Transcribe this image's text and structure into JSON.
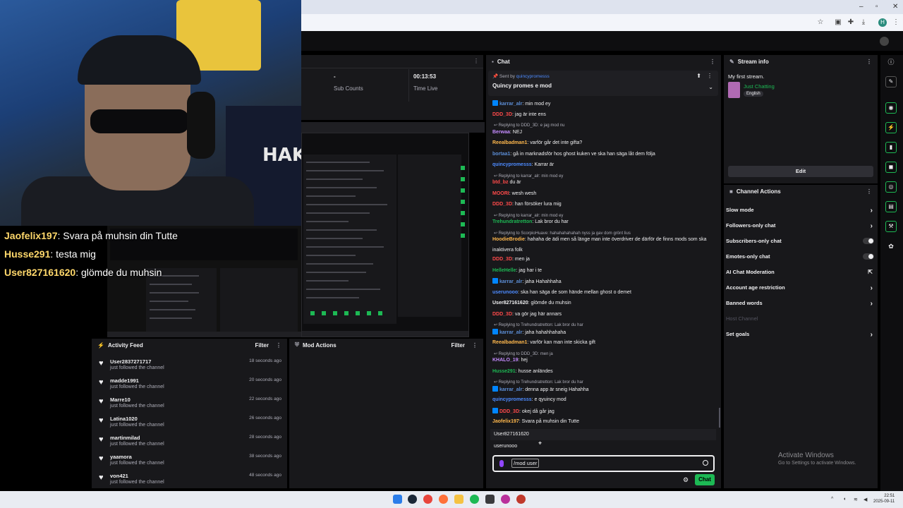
{
  "browser": {
    "profile_letter": "H"
  },
  "overlay_chat": [
    {
      "user": "Jaofelix197",
      "text": ": Svara på muhsin din Tutte"
    },
    {
      "user": "Husse291",
      "text": ": testa mig"
    },
    {
      "user": "User827161620",
      "text": ": glömde du muhsin"
    }
  ],
  "stats": {
    "dash": "-",
    "sub_counts_label": "Sub Counts",
    "time_live_value": "00:13:53",
    "time_live_label": "Time Live"
  },
  "activity_feed": {
    "title": "Activity Feed",
    "filter": "Filter",
    "items": [
      {
        "user": "User2837271717",
        "desc": "just followed the channel",
        "time": "18 seconds ago"
      },
      {
        "user": "madde1991",
        "desc": "just followed the channel",
        "time": "20 seconds ago"
      },
      {
        "user": "Marre10",
        "desc": "just followed the channel",
        "time": "22 seconds ago"
      },
      {
        "user": "Latina1020",
        "desc": "just followed the channel",
        "time": "26 seconds ago"
      },
      {
        "user": "martinmilad",
        "desc": "just followed the channel",
        "time": "28 seconds ago"
      },
      {
        "user": "yaamora",
        "desc": "just followed the channel",
        "time": "38 seconds ago"
      },
      {
        "user": "von421",
        "desc": "just followed the channel",
        "time": "48 seconds ago"
      }
    ]
  },
  "mod_actions": {
    "title": "Mod Actions",
    "filter": "Filter"
  },
  "chat": {
    "title": "Chat",
    "pinned_sent_by_prefix": "Sent by ",
    "pinned_sent_by_user": "quincypromesss",
    "pinned_text": "Quincy promes e mod",
    "messages": [
      {
        "user": "karrar_alr",
        "text": ": min mod ey",
        "color": "#5c8ed6",
        "mod": true
      },
      {
        "user": "DDD_3D",
        "text": ": jag är inte ens",
        "color": "#ff4a4a"
      },
      {
        "reply": "Replying to DDD_3D: e jag mod nu"
      },
      {
        "user": "Berwaa",
        "text": ": NEJ",
        "color": "#c58cff"
      },
      {
        "user": "Reealbadman1",
        "text": ": varför går det inte gifta?",
        "color": "#ffb84d"
      },
      {
        "user": "bortaa1",
        "text": ": gå in marknadsför hos ghost kuken ve ska han säga låt dem följa",
        "color": "#5c8ed6"
      },
      {
        "user": "quincypromesss",
        "text": ": Karrar är",
        "color": "#4d8bff"
      },
      {
        "reply": "Replying to karrar_alr: min mod ey"
      },
      {
        "user": "btd_bz",
        "text": " du är",
        "color": "#ff4a4a"
      },
      {
        "user": "MOORI",
        "text": ": wesh wesh",
        "color": "#ff4a4a"
      },
      {
        "user": "DDD_3D",
        "text": ": han försöker lura mig",
        "color": "#ff4a4a"
      },
      {
        "reply": "Replying to karrar_alr: min mod ey"
      },
      {
        "user": "Trehundratretton",
        "text": ": Lak bror du har",
        "color": "#1db954"
      },
      {
        "reply": "Replying to ScorpioHuave: hahahahahahah nyss ja gav dom grönt lius"
      },
      {
        "user": "HoodieBrodie",
        "text": ": hahaha de ädi men så länge man inte överdriver de därför de finns mods som ska",
        "color": "#ffb84d"
      },
      {
        "cont": "inaktivera folk"
      },
      {
        "user": "DDD_3D",
        "text": ": men ja",
        "color": "#ff4a4a"
      },
      {
        "user": "HelleHelle",
        "text": ": jag har i te",
        "color": "#1db954"
      },
      {
        "user": "karrar_alr",
        "text": ": jaha Hahahhaha",
        "color": "#5c8ed6",
        "mod": true
      },
      {
        "user": "userunooo",
        "text": ": ska han säga de som hände mellan ghost o demet",
        "color": "#4d8bff"
      },
      {
        "user": "User827161620",
        "text": ": glömde du muhsin",
        "color": "#efeff1"
      },
      {
        "user": "DDD_3D",
        "text": ": va gör jag här annars",
        "color": "#ff4a4a"
      },
      {
        "reply": "Replying to Trehundratretton: Lak bror du har"
      },
      {
        "user": "karrar_alr",
        "text": ": jaha hahahhahaha",
        "color": "#5c8ed6",
        "mod": true
      },
      {
        "user": "Reealbadman1",
        "text": ": varför kan man inte skicka gift",
        "color": "#ffb84d"
      },
      {
        "reply": "Replying to DDD_3D: men ja"
      },
      {
        "user": "KHALO_19",
        "text": ": hej",
        "color": "#c58cff"
      },
      {
        "user": "Husse291",
        "text": ": husse anländes",
        "color": "#1db954"
      },
      {
        "reply": "Replying to Trehundratretton: Lak bror du har"
      },
      {
        "user": "karrar_alr",
        "text": ": denna app är sneig Hahahha",
        "color": "#5c8ed6",
        "mod": true
      },
      {
        "user": "quincypromesss",
        "text": ": e qyuincy mod",
        "color": "#4d8bff"
      },
      {
        "user": "DDD_3D",
        "text": ": okej då går jag",
        "color": "#ff4a4a",
        "mod": true
      },
      {
        "user": "Jaofelix197",
        "text": ": Svara på muhsin din Tutte",
        "color": "#ffb84d"
      },
      {
        "user": "Husse291",
        "text": ": testa mig",
        "color": "#1db954"
      }
    ],
    "suggestions": [
      "User827161620",
      "userunooo"
    ],
    "input_value": "/mod user",
    "send_label": "Chat"
  },
  "stream_info": {
    "title": "Stream info",
    "stream_title": "My first stream.",
    "category": "Just Chatting",
    "tag": "English",
    "edit_label": "Edit"
  },
  "channel_actions": {
    "title": "Channel Actions",
    "items": [
      {
        "label": "Slow mode",
        "kind": "arrow"
      },
      {
        "label": "Followers-only chat",
        "kind": "arrow"
      },
      {
        "label": "Subscribers-only chat",
        "kind": "toggle"
      },
      {
        "label": "Emotes-only chat",
        "kind": "toggle"
      },
      {
        "label": "AI Chat Moderation",
        "kind": "external"
      },
      {
        "label": "Account age restriction",
        "kind": "arrow"
      },
      {
        "label": "Banned words",
        "kind": "arrow"
      },
      {
        "label": "Host Channel",
        "kind": "dim"
      },
      {
        "label": "Set goals",
        "kind": "arrow"
      }
    ]
  },
  "watermark": {
    "line1": "Activate Windows",
    "line2": "Go to Settings to activate Windows."
  },
  "clock": {
    "time": "22:51",
    "date": "2025-09-11"
  }
}
